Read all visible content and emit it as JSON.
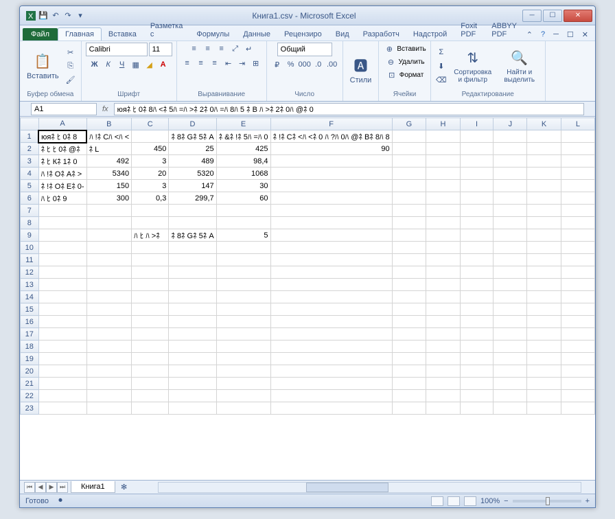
{
  "title": "Книга1.csv - Microsoft Excel",
  "qat": {
    "save": "💾",
    "undo": "↶",
    "redo": "↷"
  },
  "tabs": {
    "file": "Файл",
    "home": "Главная",
    "insert": "Вставка",
    "layout": "Разметка с",
    "formulas": "Формулы",
    "data": "Данные",
    "review": "Рецензиро",
    "view": "Вид",
    "dev": "Разработч",
    "addins": "Надстрой",
    "foxit": "Foxit PDF",
    "abbyy": "ABBYY PDF"
  },
  "groups": {
    "clipboard": {
      "label": "Буфер обмена",
      "paste": "Вставить"
    },
    "font": {
      "label": "Шрифт",
      "name": "Calibri",
      "size": "11"
    },
    "align": {
      "label": "Выравнивание"
    },
    "number": {
      "label": "Число",
      "format": "Общий"
    },
    "styles": {
      "label": "Стили",
      "btn": "Стили"
    },
    "cells": {
      "label": "Ячейки",
      "insert": "Вставить",
      "delete": "Удалить",
      "format": "Формат"
    },
    "editing": {
      "label": "Редактирование",
      "sort": "Сортировка и фильтр",
      "find": "Найти и выделить"
    }
  },
  "namebox": "A1",
  "formula": "юяﾈ ﾋ 0ﾈ 8ﾊ <ﾈ 5ﾊ =ﾊ >ﾈ 2ﾈ 0ﾊ =ﾊ 8ﾊ 5 ﾈ В ﾊ >ﾈ 2ﾈ 0ﾊ @ﾈ 0",
  "columns": [
    "A",
    "B",
    "C",
    "D",
    "E",
    "F",
    "G",
    "H",
    "I",
    "J",
    "K",
    "L"
  ],
  "rows": [
    1,
    2,
    3,
    4,
    5,
    6,
    7,
    8,
    9,
    10,
    11,
    12,
    13,
    14,
    15,
    16,
    17,
    18,
    19,
    20,
    21,
    22,
    23
  ],
  "cells": {
    "A1": "юяﾈ ﾋ 0ﾈ 8",
    "B1": "ﾊ !ﾈ Сﾊ <ﾊ <",
    "C1": "",
    "D1": "ﾈ 8ﾈ Gﾈ 5ﾈ A",
    "E1": "ﾈ &ﾈ !ﾈ 5ﾊ =ﾊ 0",
    "F1": "ﾈ !ﾈ Сﾈ <ﾊ <ﾈ 0 ﾊ ?ﾊ 0ﾊ @ﾈ Вﾈ 8ﾊ 8",
    "G1": "",
    "H1": "",
    "A2": "ﾈ ﾋ ﾋ 0ﾈ @ﾈ ",
    "B2": "ﾈ L",
    "C2": "450",
    "D2": "25",
    "E2": "425",
    "F2": "90",
    "A3": "ﾈ ﾋ Кﾈ 1ﾈ 0",
    "B3": "492",
    "C3": "3",
    "D3": "489",
    "E3": "98,4",
    "A4": "ﾊ !ﾈ Оﾈ Aﾈ >",
    "B4": "5340",
    "C4": "20",
    "D4": "5320",
    "E4": "1068",
    "A5": "ﾈ !ﾈ Оﾈ Eﾈ 0-",
    "B5": "150",
    "C5": "3",
    "D5": "147",
    "E5": "30",
    "A6": "ﾊ ﾋ 0ﾈ 9",
    "B6": "300",
    "C6": "0,3",
    "D6": "299,7",
    "E6": "60",
    "C9": "ﾊ ﾋ ﾊ >ﾈ",
    "D9": "ﾈ 8ﾈ Gﾈ 5ﾈ A",
    "E9": "5"
  },
  "sheet": "Книга1",
  "status": "Готово",
  "zoom": "100%"
}
